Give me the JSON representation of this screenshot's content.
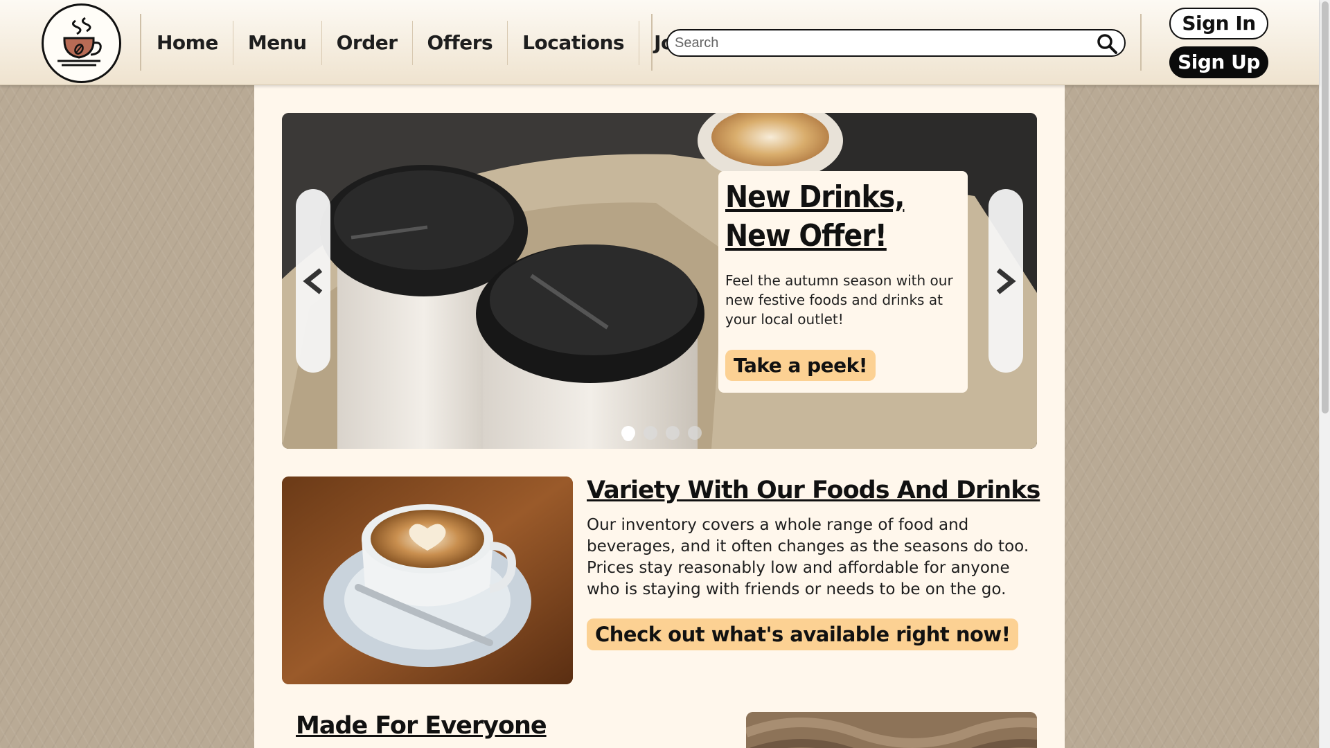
{
  "header": {
    "nav": [
      "Home",
      "Menu",
      "Order",
      "Offers",
      "Locations",
      "Jobs"
    ],
    "search_placeholder": "Search",
    "signin_label": "Sign In",
    "signup_label": "Sign Up"
  },
  "carousel": {
    "title": "New Drinks, New Offer!",
    "text": "Feel the autumn season with our new festive foods and drinks at your local outlet!",
    "button_label": "Take a peek!",
    "active_slide": 1,
    "slide_count": 4
  },
  "feature": {
    "title": "Variety With Our Foods And Drinks",
    "text": "Our inventory covers a whole range of food and beverages, and it often changes as the seasons do too. Prices stay reasonably low and affordable for anyone who is staying with friends or needs to be on the go.",
    "button_label": "Check out what's available right now!"
  },
  "section2": {
    "title": "Made For Everyone"
  },
  "colors": {
    "accent_button": "#fcd193",
    "panel": "#fff7ec",
    "page_background": "#b9aa95",
    "signup": "#0b0b0b"
  },
  "icons": {
    "logo": "coffee-cup-logo-icon",
    "search": "magnifier-icon",
    "prev": "chevron-left-icon",
    "next": "chevron-right-icon"
  }
}
